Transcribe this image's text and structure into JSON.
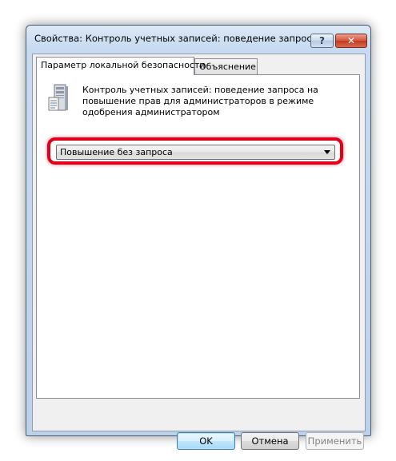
{
  "window": {
    "title": "Свойства: Контроль учетных записей: поведение запроса на...",
    "help_label": "?",
    "close_label": "✕"
  },
  "tabs": [
    {
      "label": "Параметр локальной безопасности",
      "active": true
    },
    {
      "label": "Объяснение",
      "active": false
    }
  ],
  "policy": {
    "icon": "server-policy-icon",
    "description": "Контроль учетных записей: поведение запроса на повышение прав для администраторов в режиме одобрения администратором"
  },
  "dropdown": {
    "selected": "Повышение без запроса"
  },
  "buttons": {
    "ok": "OK",
    "cancel": "Отмена",
    "apply": "Применить"
  },
  "colors": {
    "highlight": "#e0001a",
    "close_button": "#c0391f"
  }
}
